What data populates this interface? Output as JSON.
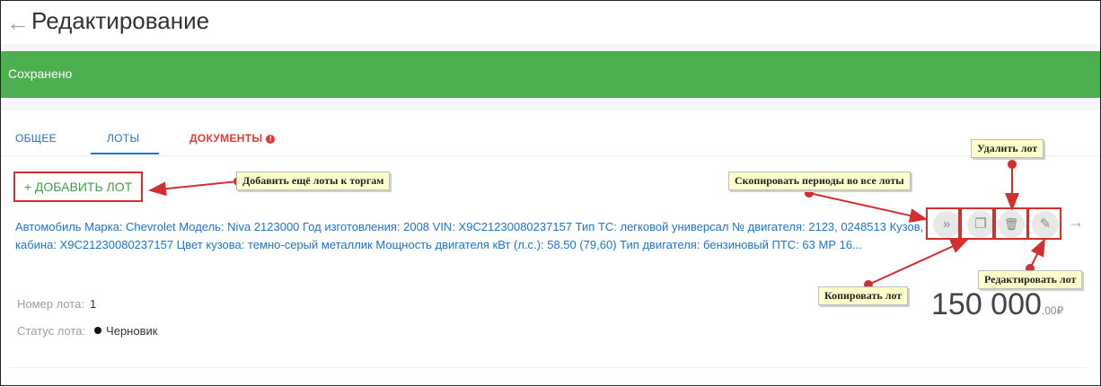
{
  "header": {
    "back_icon": "arrow-left-icon",
    "title": "Редактирование"
  },
  "notification": {
    "text": "Сохранено",
    "color": "#4caf50"
  },
  "tabs": [
    {
      "label": "ОБЩЕЕ"
    },
    {
      "label": "ЛОТЫ",
      "active": true
    },
    {
      "label": "ДОКУМЕНТЫ",
      "badge": "!",
      "color": "#e53935"
    }
  ],
  "add_lot_button": {
    "label": "+ ДОБАВИТЬ ЛОТ"
  },
  "lot": {
    "description": "Автомобиль Марка: Chevrolet Модель: Niva 2123000 Год изготовления: 2008 VIN: X9C21230080237157 Тип ТС: легковой универсал № двигателя: 2123, 0248513 Кузов, кабина: X9C21230080237157 Цвет кузова: темно-серый металлик Мощность двигателя кВт (л.с.): 58.50 (79,60) Тип двигателя: бензиновый ПТС: 63 МР 16...",
    "number_label": "Номер лота:",
    "number_value": "1",
    "status_label": "Статус лота:",
    "status_value": "Черновик",
    "price_main": "150 000",
    "price_cents": ".00",
    "currency": "₽"
  },
  "actions": [
    {
      "name": "copy-periods-to-all-icon",
      "glyph": "»"
    },
    {
      "name": "copy-lot-icon",
      "glyph": "❐"
    },
    {
      "name": "delete-lot-icon",
      "glyph": "🗑"
    },
    {
      "name": "edit-lot-icon",
      "glyph": "✎"
    }
  ],
  "callouts": {
    "add_more_lots": "Добавить ещё лоты к торгам",
    "copy_periods": "Скопировать периоды во все лоты",
    "delete_lot": "Удалить лот",
    "copy_lot": "Копировать лот",
    "edit_lot": "Редактировать лот"
  },
  "accent_colors": {
    "primary": "#1976d2",
    "annotation": "#d32f2f",
    "success": "#43a047"
  }
}
